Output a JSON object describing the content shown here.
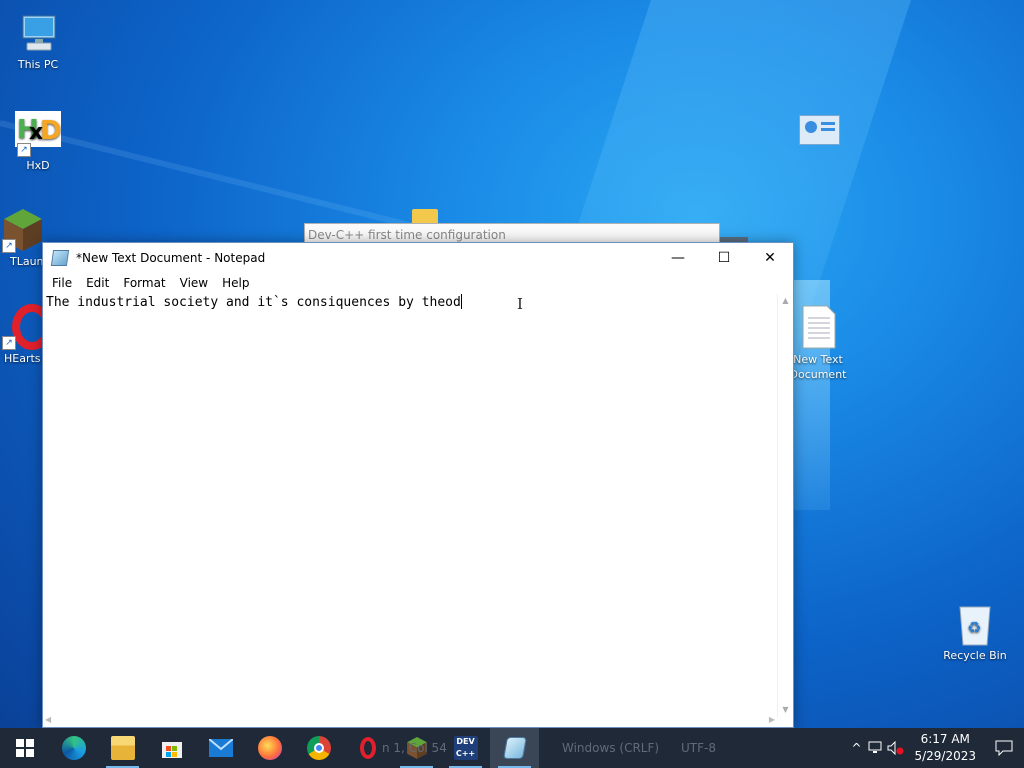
{
  "desktop": {
    "icons": [
      {
        "label": "This PC",
        "icon": "computer-icon"
      },
      {
        "label": "HxD",
        "icon": "hxd-icon"
      },
      {
        "label": "TLaun",
        "icon": "minecraft-launcher-icon"
      },
      {
        "label": "HEarts",
        "icon": "opera-shortcut-icon"
      },
      {
        "label": "New Text\nDocument",
        "icon": "text-document-icon"
      },
      {
        "label": "Recycle Bin",
        "icon": "recycle-bin-icon"
      }
    ]
  },
  "background_window": {
    "title": "Dev-C++ first time configuration"
  },
  "notepad": {
    "title": "*New Text Document - Notepad",
    "menu": [
      "File",
      "Edit",
      "Format",
      "View",
      "Help"
    ],
    "content": "The industrial society and it`s consiquences by theod",
    "minimize": "—",
    "maximize": "☐",
    "close": "✕"
  },
  "taskbar": {
    "apps": [
      {
        "name": "Microsoft Edge",
        "icon": "edge-icon"
      },
      {
        "name": "File Explorer",
        "icon": "file-explorer-icon"
      },
      {
        "name": "Microsoft Store",
        "icon": "store-icon"
      },
      {
        "name": "Mail",
        "icon": "mail-icon"
      },
      {
        "name": "Firefox",
        "icon": "firefox-icon"
      },
      {
        "name": "Chrome",
        "icon": "chrome-icon"
      },
      {
        "name": "Opera",
        "icon": "opera-icon"
      },
      {
        "name": "Minecraft",
        "icon": "minecraft-icon"
      },
      {
        "name": "Dev-C++",
        "icon": "devcpp-icon"
      },
      {
        "name": "Notepad",
        "icon": "notepad-icon"
      }
    ],
    "ghost_status": {
      "line": "n 1, Col 54",
      "eol": "Windows (CRLF)",
      "encoding": "UTF-8"
    },
    "clock": {
      "time": "6:17 AM",
      "date": "5/29/2023"
    }
  },
  "colors": {
    "taskbar": "#1f2938",
    "accent": "#76b9ed",
    "desktop": "#0d64c9"
  }
}
